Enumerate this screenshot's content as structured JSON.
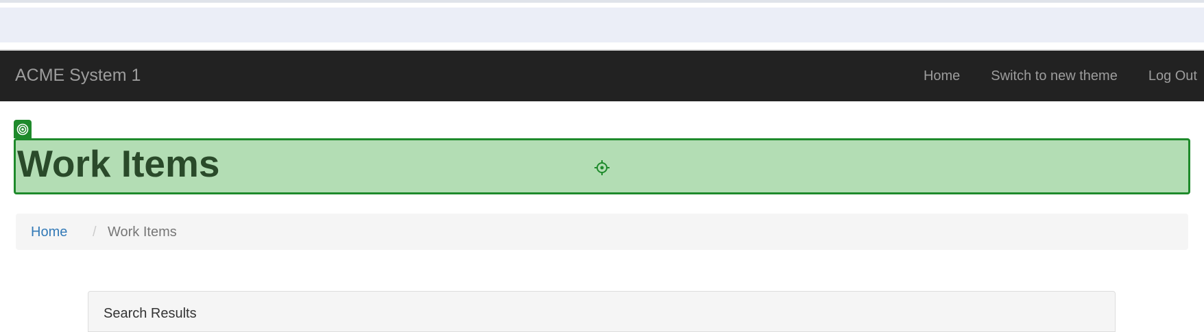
{
  "navbar": {
    "brand": "ACME System 1",
    "links": [
      "Home",
      "Switch to new theme",
      "Log Out"
    ]
  },
  "page": {
    "title": "Work Items"
  },
  "breadcrumb": {
    "home": "Home",
    "separator": "/",
    "current": "Work Items"
  },
  "panel": {
    "title": "Search Results"
  },
  "colors": {
    "navbar_bg": "#222222",
    "highlight_fill": "#b3ddb4",
    "highlight_border": "#1e8a2b",
    "link": "#337ab7"
  },
  "icons": {
    "marker": "target-icon",
    "cursor": "crosshair-icon"
  }
}
